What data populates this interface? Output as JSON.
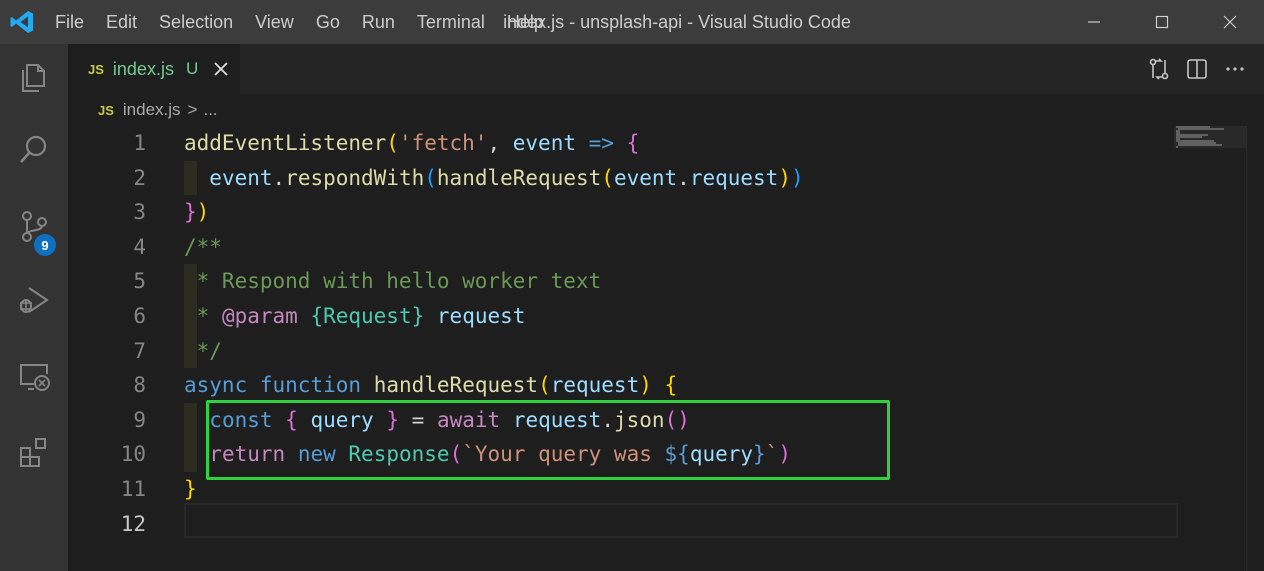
{
  "titlebar": {
    "menu": [
      "File",
      "Edit",
      "Selection",
      "View",
      "Go",
      "Run",
      "Terminal",
      "Help"
    ],
    "window_title": "index.js - unsplash-api - Visual Studio Code"
  },
  "activitybar": {
    "items": [
      "explorer-icon",
      "search-icon",
      "source-control-icon",
      "run-debug-icon",
      "remote-explorer-icon",
      "extensions-icon"
    ],
    "source_control_badge": "9"
  },
  "tab": {
    "file_type": "JS",
    "label": "index.js",
    "status": "U"
  },
  "breadcrumb": {
    "file_type": "JS",
    "file": "index.js",
    "separator": ">",
    "more": "..."
  },
  "editor": {
    "language": "javascript",
    "active_line": "12",
    "line_numbers": [
      "1",
      "2",
      "3",
      "4",
      "5",
      "6",
      "7",
      "8",
      "9",
      "10",
      "11",
      "12"
    ],
    "lines": [
      "addEventListener('fetch', event => {",
      "  event.respondWith(handleRequest(event.request))",
      "})",
      "/**",
      " * Respond with hello worker text",
      " * @param {Request} request",
      " */",
      "async function handleRequest(request) {",
      "  const { query } = await request.json()",
      "  return new Response(`Your query was ${query}`)",
      "}",
      ""
    ],
    "highlighted_lines": "9-10",
    "highlight_color": "#2ed33f"
  },
  "colors": {
    "titlebar_bg": "#3c3c3c",
    "activitybar_bg": "#333333",
    "editor_bg": "#1e1e1e",
    "badge_bg": "#0e70c0",
    "accent_logo": "#23a9f2"
  }
}
